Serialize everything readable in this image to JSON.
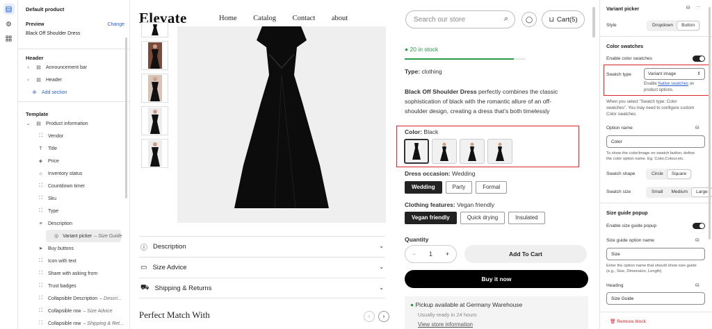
{
  "left_panel": {
    "section_title": "Default product",
    "preview_label": "Preview",
    "preview_change": "Change",
    "preview_value": "Black Off Shoulder Dress",
    "header_group": "Header",
    "header_items": [
      "Announcement bar",
      "Header"
    ],
    "add_section": "Add section",
    "template_group": "Template",
    "product_information": "Product information",
    "blocks": [
      {
        "label": "Vendor",
        "icon": "corners-icon"
      },
      {
        "label": "Title",
        "icon": "text-icon"
      },
      {
        "label": "Price",
        "icon": "tag-icon"
      },
      {
        "label": "Inventory status",
        "icon": "box-icon"
      },
      {
        "label": "Countdown timer",
        "icon": "corners-icon"
      },
      {
        "label": "Sku",
        "icon": "corners-icon"
      },
      {
        "label": "Type",
        "icon": "corners-icon"
      },
      {
        "label": "Description",
        "icon": "lines-icon"
      }
    ],
    "selected_block": {
      "label": "Variant picker",
      "suffix": "– Size Guide"
    },
    "blocks_after": [
      {
        "label": "Buy buttons",
        "icon": "cursor-icon"
      },
      {
        "label": "Icon with text",
        "icon": "corners-icon"
      },
      {
        "label": "Share with asking from",
        "icon": "corners-icon"
      },
      {
        "label": "Trust badges",
        "icon": "corners-icon"
      },
      {
        "label": "Collapsible Description",
        "suffix": "– Descri...",
        "icon": "corners-icon"
      },
      {
        "label": "Collapsible row",
        "suffix": "– Size Advice",
        "icon": "corners-icon"
      },
      {
        "label": "Collapsible row",
        "suffix": "– Shipping & Ret...",
        "icon": "corners-icon"
      },
      {
        "label": "Complementary products",
        "icon": "corners-icon"
      }
    ]
  },
  "store": {
    "logo": "Elevate",
    "nav": [
      "Home",
      "Catalog",
      "Contact",
      "about"
    ],
    "search_placeholder": "Search our store",
    "cart_label": "Cart(5)",
    "accordion": [
      {
        "label": "Description",
        "icon": "info-icon"
      },
      {
        "label": "Size Advice",
        "icon": "ruler-icon"
      },
      {
        "label": "Shipping & Returns",
        "icon": "truck-icon"
      }
    ],
    "section_heading": "Perfect Match With"
  },
  "product": {
    "stock": "20 in stock",
    "stock_level": 0.9,
    "type_label": "Type:",
    "type_value": "clothing",
    "desc_bold": "Black Off Shoulder Dress",
    "desc_rest": " perfectly combines the classic sophistication of black with the romantic allure of an off-shoulder design, creating a dress that's both timelessly",
    "color_label": "Color:",
    "color_value": "Black",
    "occasion_label": "Dress occasion:",
    "occasion_value": "Wedding",
    "occasion_options": [
      "Wedding",
      "Party",
      "Formal"
    ],
    "features_label": "Clothing features:",
    "features_value": "Vegan friendly",
    "features_options": [
      "Vegan friendly",
      "Quick drying",
      "Insulated"
    ],
    "quantity_label": "Quantity",
    "quantity_value": "1",
    "add_to_cart": "Add To Cart",
    "buy_now": "Buy it now",
    "pickup_prefix": "Pickup available at",
    "pickup_location": "Germany Warehouse",
    "pickup_time": "Usually ready in 24 hours",
    "pickup_link": "View store information"
  },
  "right_panel": {
    "title": "Variant picker",
    "style_label": "Style",
    "style_options": [
      "Dropdown",
      "Button"
    ],
    "color_swatches_heading": "Color swatches",
    "enable_color_swatches": "Enable color swatches",
    "swatch_type_label": "Swatch type",
    "swatch_type_value": "Variant image",
    "swatch_help_prefix": "Enable",
    "swatch_help_link": "Native swatches",
    "swatch_help_suffix": "on",
    "swatch_help_line2": "product options.",
    "swatch_note_1": "When you select \"Swatch type: Color",
    "swatch_note_2": "swatches\". You may need to configure custom",
    "swatch_note_3": "Color swatches",
    "option_name_label": "Option name",
    "option_name_value": "Color",
    "option_help_1": "To show the color/image on swatch button, define",
    "option_help_2": "the color option name. Eg. Color,Colour,etc.",
    "swatch_shape_label": "Swatch shape",
    "swatch_shape_options": [
      "Circle",
      "Square"
    ],
    "swatch_size_label": "Swatch size",
    "swatch_size_options": [
      "Small",
      "Medium",
      "Large"
    ],
    "size_guide_heading": "Size guide popup",
    "enable_size_guide": "Enable size guide popup",
    "size_option_label": "Size guide option name",
    "size_option_value": "Size",
    "size_help_1": "Enter the option name that should show size guide",
    "size_help_2": "(e.g., Size, Dimension, Length)",
    "heading_label": "Heading",
    "heading_value": "Size Guide",
    "remove_block": "Remove block"
  }
}
